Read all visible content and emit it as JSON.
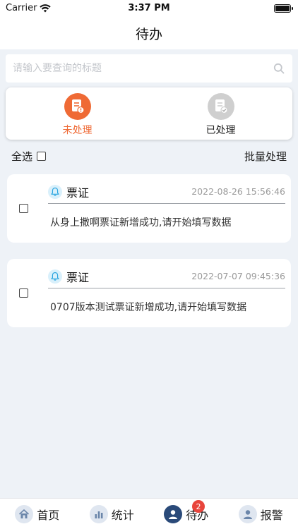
{
  "status_bar": {
    "carrier": "Carrier",
    "time": "3:37 PM"
  },
  "nav": {
    "title": "待办"
  },
  "search": {
    "placeholder": "请输入要查询的标题",
    "icon": "search-icon"
  },
  "tabs": [
    {
      "label": "未处理",
      "active": true,
      "color": "#ef6a35",
      "icon": "pending-doc-icon"
    },
    {
      "label": "已处理",
      "active": false,
      "color": "#cfcfcf",
      "icon": "done-doc-icon"
    }
  ],
  "toolbar": {
    "select_all": "全选",
    "batch": "批量处理"
  },
  "items": [
    {
      "title": "票证",
      "date": "2022-08-26 15:56:46",
      "message": "从身上撒啊票证新增成功,请开始填写数据"
    },
    {
      "title": "票证",
      "date": "2022-07-07 09:45:36",
      "message": "0707版本测试票证新增成功,请开始填写数据"
    }
  ],
  "tabbar": [
    {
      "label": "首页",
      "icon": "home-icon"
    },
    {
      "label": "统计",
      "icon": "chart-icon"
    },
    {
      "label": "待办",
      "icon": "user-icon",
      "badge": "2",
      "active": true
    },
    {
      "label": "报警",
      "icon": "user-icon"
    }
  ],
  "colors": {
    "accent": "#ef6a35",
    "nav_active": "#2a4a79",
    "badge": "#e8453c",
    "background": "#eef2f7"
  }
}
